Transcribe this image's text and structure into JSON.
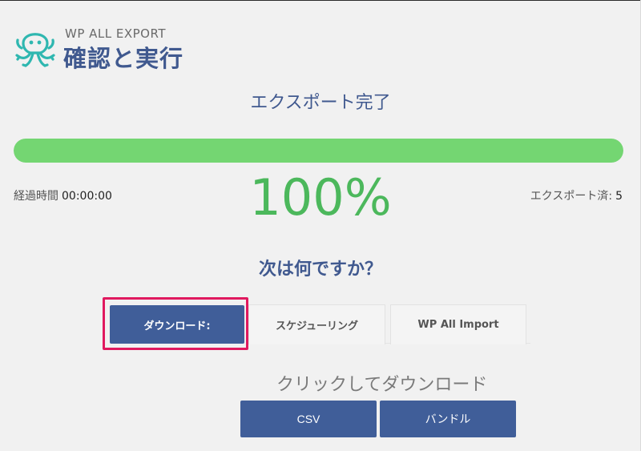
{
  "brand": {
    "product": "WP ALL EXPORT",
    "heading": "確認と実行",
    "accent_color": "#40598f",
    "logo_color": "#2fb7b0",
    "logo_icon": "octopus-logo"
  },
  "status": {
    "title": "エクスポート完了",
    "progress_fraction": 1.0,
    "progress_color": "#74d672",
    "percent_text": "100%",
    "elapsed_label": "経過時間",
    "elapsed_value": "00:00:00",
    "exported_label": "エクスポート済:",
    "exported_value": "5"
  },
  "next": {
    "question": "次は何ですか？",
    "tabs": [
      {
        "label": "ダウンロード:",
        "active": true
      },
      {
        "label": "スケジューリング",
        "active": false
      },
      {
        "label": "WP All Import",
        "active": false
      }
    ],
    "highlight_color": "#e0195f"
  },
  "download": {
    "prompt": "クリックしてダウンロード",
    "buttons": [
      {
        "label": "CSV"
      },
      {
        "label": "バンドル"
      }
    ]
  }
}
